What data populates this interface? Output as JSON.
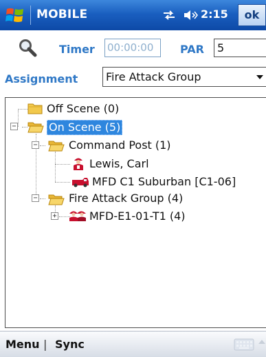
{
  "titlebar": {
    "title": "MOBILE",
    "time": "2:15",
    "ok_label": "ok"
  },
  "form": {
    "timer_label": "Timer",
    "timer_value": "00:00:00",
    "par_label": "PAR",
    "par_value": "5",
    "assignment_label": "Assignment",
    "assignment_value": "Fire Attack Group"
  },
  "tree": {
    "off_scene": "Off Scene (0)",
    "on_scene": "On Scene (5)",
    "command_post": "Command Post (1)",
    "lewis": "Lewis, Carl",
    "suburban": "MFD C1 Suburban [C1-06]",
    "fire_attack": "Fire Attack Group (4)",
    "engine": "MFD-E1-01-T1 (4)"
  },
  "menubar": {
    "menu_label": "Menu",
    "separator": "|",
    "sync_label": "Sync"
  },
  "colors": {
    "titlebar": "#1a5fc0",
    "label_blue": "#2f78c6",
    "selection": "#2e86de",
    "folder": "#f2c94c",
    "unit_red": "#c8102e"
  }
}
